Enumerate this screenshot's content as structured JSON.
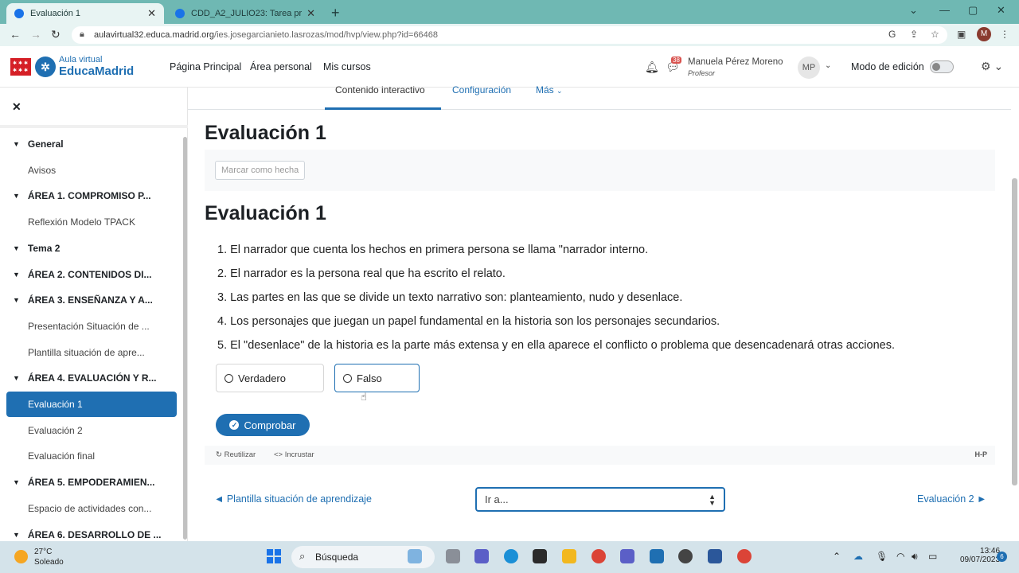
{
  "browser": {
    "tabs": [
      {
        "label": "Evaluación 1",
        "active": true
      },
      {
        "label": "CDD_A2_JULIO23: Tarea práctica",
        "active": false
      }
    ],
    "url_host": "aulavirtual32.educa.madrid.org",
    "url_path": "/ies.josegarcianieto.lasrozas/mod/hvp/view.php?id=66468",
    "profile_initial": "M"
  },
  "header": {
    "logo_top": "Aula virtual",
    "logo_bottom": "EducaMadrid",
    "nav": [
      "Página Principal",
      "Área personal",
      "Mis cursos"
    ],
    "notification_count": "38",
    "user_name": "Manuela Pérez Moreno",
    "user_role": "Profesor",
    "avatar_initials": "MP",
    "edit_mode_label": "Modo de edición",
    "edit_mode_on": false
  },
  "sidebar": {
    "items": [
      {
        "label": "General",
        "type": "section"
      },
      {
        "label": "Avisos",
        "type": "leaf"
      },
      {
        "label": "ÁREA 1. COMPROMISO P...",
        "type": "section"
      },
      {
        "label": "Reflexión Modelo TPACK",
        "type": "leaf"
      },
      {
        "label": "Tema 2",
        "type": "section"
      },
      {
        "label": "ÁREA 2. CONTENIDOS DI...",
        "type": "section"
      },
      {
        "label": "ÁREA 3. ENSEÑANZA Y A...",
        "type": "section"
      },
      {
        "label": "Presentación Situación de ...",
        "type": "leaf"
      },
      {
        "label": "Plantilla situación de apre...",
        "type": "leaf"
      },
      {
        "label": "ÁREA 4. EVALUACIÓN Y R...",
        "type": "section"
      },
      {
        "label": "Evaluación 1",
        "type": "leaf",
        "active": true
      },
      {
        "label": "Evaluación 2",
        "type": "leaf"
      },
      {
        "label": "Evaluación final",
        "type": "leaf"
      },
      {
        "label": "ÁREA 5. EMPODERAMIEN...",
        "type": "section"
      },
      {
        "label": "Espacio de actividades con...",
        "type": "leaf"
      },
      {
        "label": "ÁREA 6. DESARROLLO DE ...",
        "type": "section"
      }
    ]
  },
  "main": {
    "tabs": [
      "Contenido interactivo",
      "Configuración",
      "Más"
    ],
    "title": "Evaluación 1",
    "mark_done_label": "Marcar como hecha",
    "activity_title": "Evaluación 1",
    "questions": [
      "1. El narrador que cuenta los hechos en primera persona se llama \"narrador interno.",
      "2. El narrador es la persona real que ha escrito el relato.",
      "3. Las partes en las que se divide un texto narrativo son: planteamiento, nudo y desenlace.",
      "4. Los personajes que juegan un papel fundamental en la historia son los personajes secundarios.",
      "5. El \"desenlace\" de la historia es la parte más extensa y en ella aparece el conflicto o problema que desencadenará otras acciones."
    ],
    "answer_true": "Verdadero",
    "answer_false": "Falso",
    "check_label": "Comprobar",
    "reuse_label": "Reutilizar",
    "embed_label": "Incrustar",
    "h5p_logo": "H-P",
    "prev_link": "◄ Plantilla situación de aprendizaje",
    "jump_placeholder": "Ir a...",
    "next_link": "Evaluación 2 ►"
  },
  "taskbar": {
    "temperature": "27°C",
    "condition": "Soleado",
    "search_label": "Búsqueda",
    "time": "13:46",
    "date": "09/07/2023",
    "notifications": "6"
  }
}
